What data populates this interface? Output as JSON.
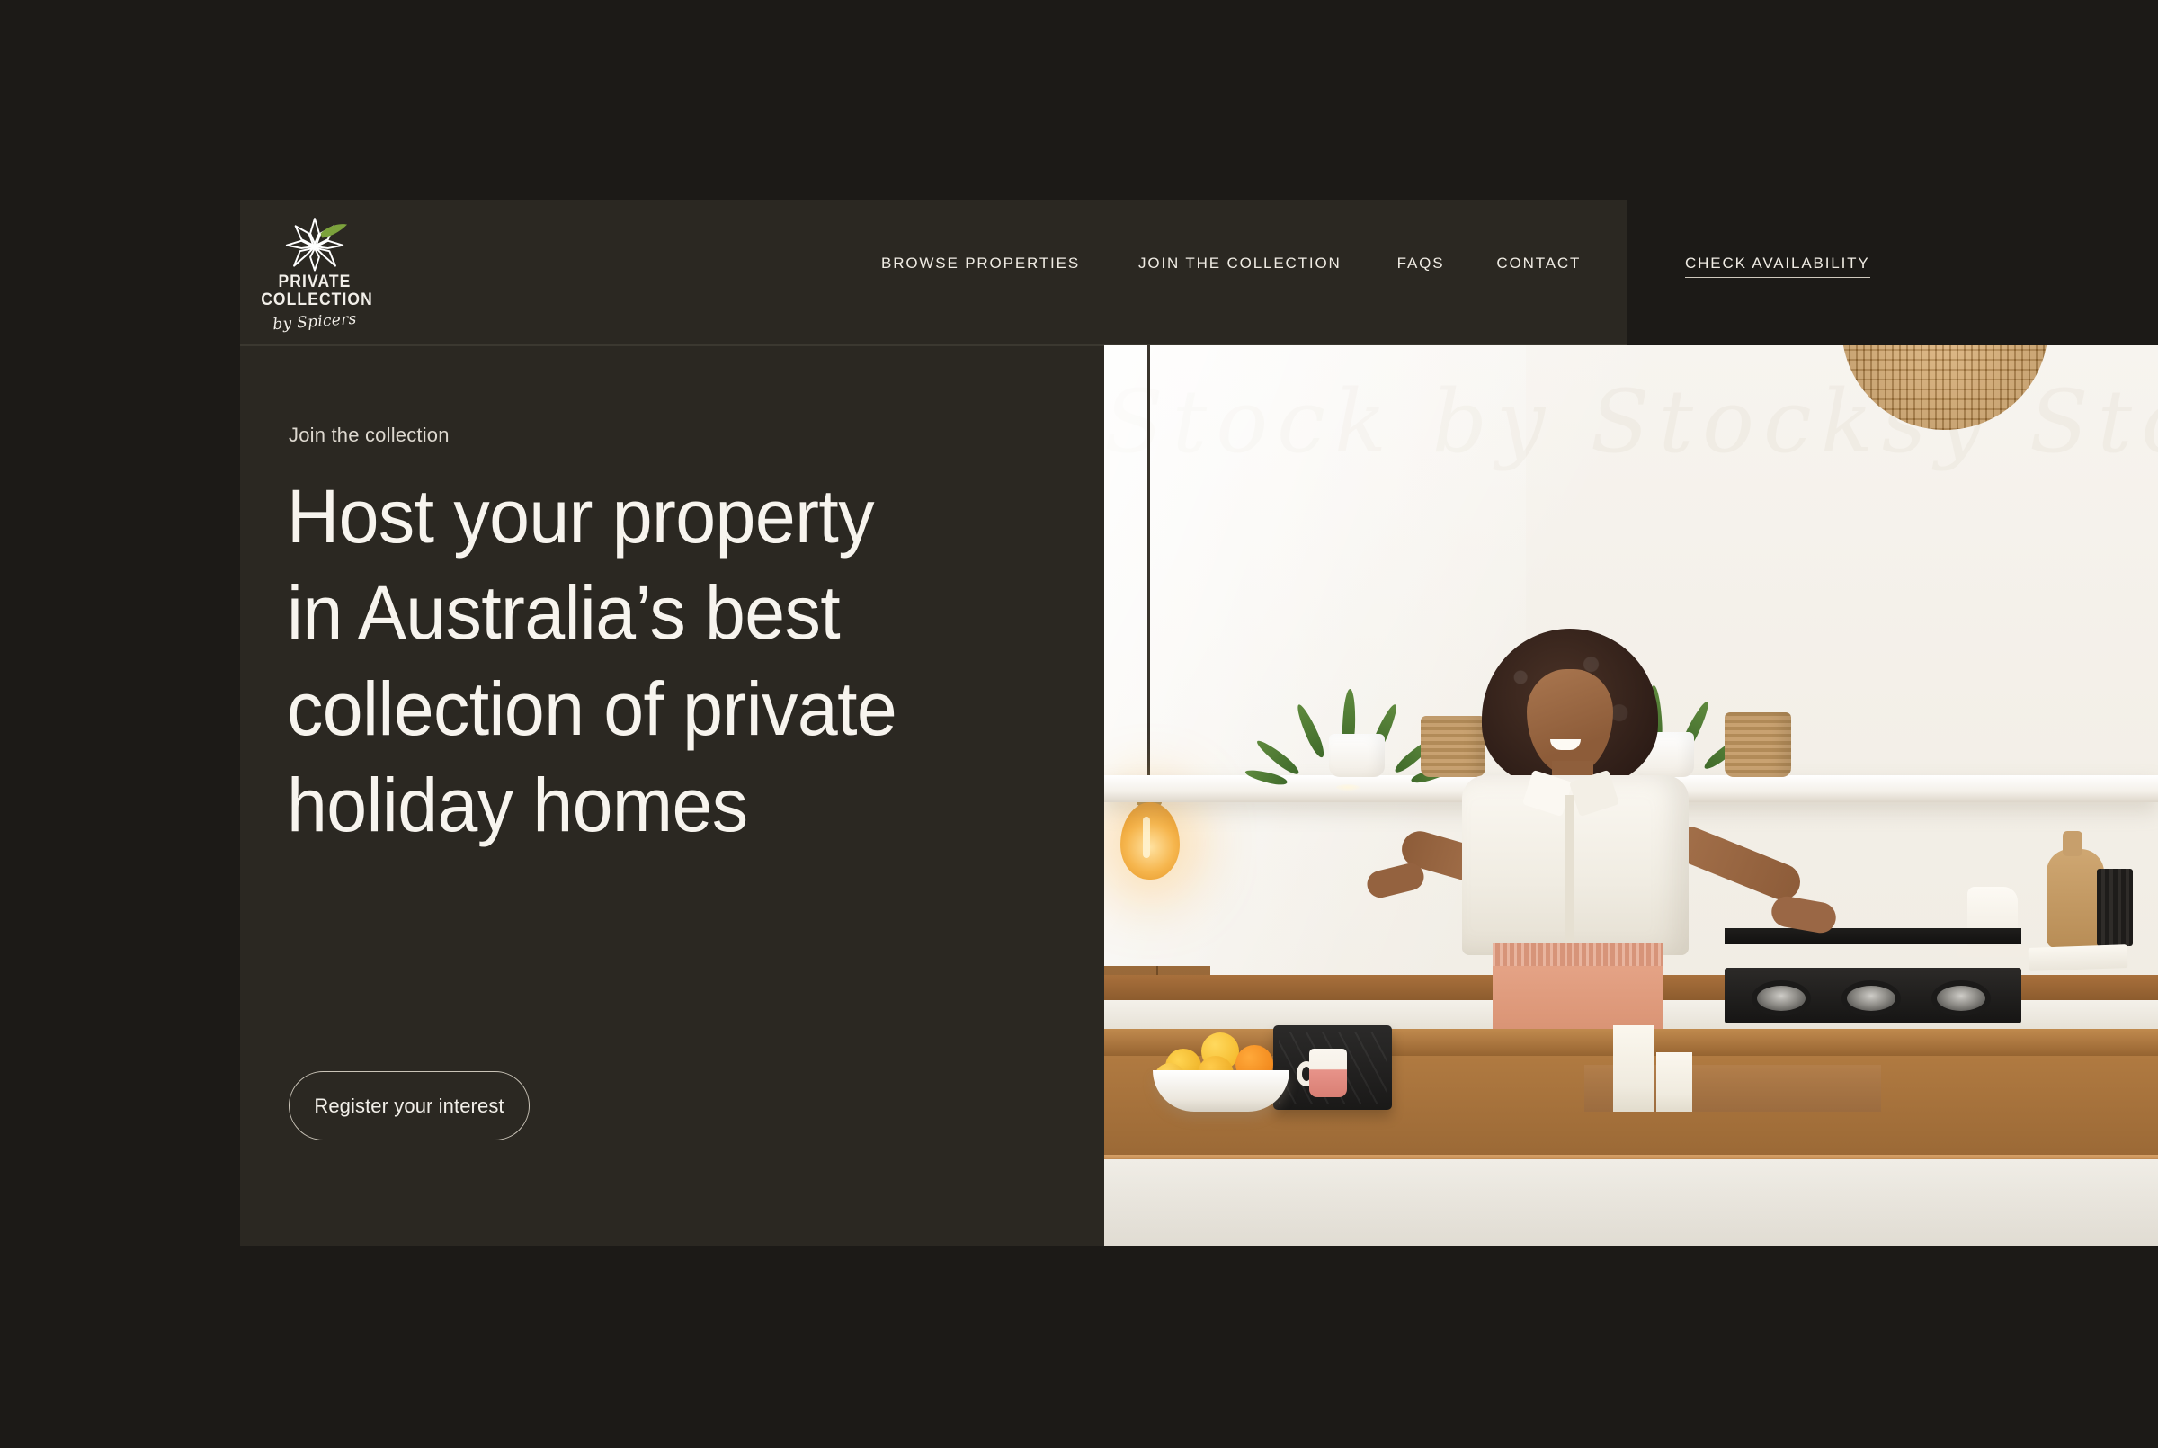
{
  "brand": {
    "name_line1": "PRIVATE",
    "name_line2": "COLLECTION",
    "tagline": "by Spicers",
    "logo_icon": "star-flower-logo",
    "leaf_color": "#7CA23C"
  },
  "nav": {
    "items": [
      {
        "label": "BROWSE PROPERTIES",
        "name": "nav-browse-properties"
      },
      {
        "label": "JOIN THE COLLECTION",
        "name": "nav-join-the-collection"
      },
      {
        "label": "FAQS",
        "name": "nav-faqs"
      },
      {
        "label": "CONTACT",
        "name": "nav-contact"
      }
    ],
    "cta": "CHECK AVAILABILITY"
  },
  "hero": {
    "eyebrow": "Join the collection",
    "headline_line1": "Host your property",
    "headline_line2": "in Australia’s best",
    "headline_line3": "collection of private",
    "headline_line4": "holiday homes",
    "button": "Register your interest",
    "image_alt": "Smiling woman standing at a wooden kitchen island in a bright coastal kitchen",
    "script_texture": "Stock by Stocksy Stock by Stocksy"
  },
  "theme": {
    "page_background": "#1c1a17",
    "panel_background": "#2b2822",
    "text_primary": "#f7f4ee",
    "text_muted": "#ddd8cf",
    "border": "#cac4b8"
  }
}
